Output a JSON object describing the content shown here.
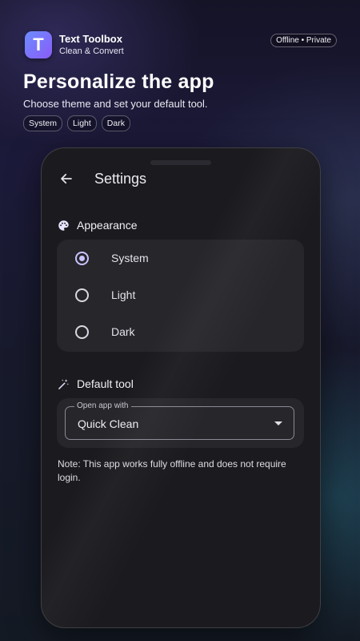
{
  "header": {
    "logo_letter": "T",
    "app_name": "Text Toolbox",
    "app_subtitle": "Clean & Convert",
    "badge": "Offline • Private"
  },
  "promo": {
    "headline": "Personalize the app",
    "subline": "Choose theme and set your default tool.",
    "chips": [
      "System",
      "Light",
      "Dark"
    ]
  },
  "settings": {
    "title": "Settings",
    "appearance": {
      "heading": "Appearance",
      "icon": "palette-icon",
      "options": [
        "System",
        "Light",
        "Dark"
      ],
      "selected": "System"
    },
    "default_tool": {
      "heading": "Default tool",
      "icon": "magic-wand-icon",
      "field_label": "Open app with",
      "value": "Quick Clean"
    },
    "note": "Note: This app works fully offline and does not require login."
  },
  "colors": {
    "accent": "#c9c2ff",
    "logo_gradient_start": "#6c8cff",
    "logo_gradient_end": "#8a5cf6",
    "phone_bg": "#1b1b1f",
    "card_bg": "#26262b"
  }
}
